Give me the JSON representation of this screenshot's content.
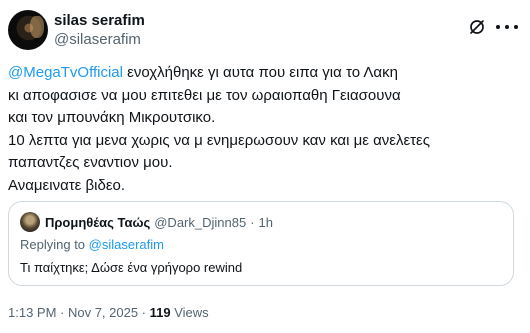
{
  "author": {
    "display_name": "silas serafim",
    "handle": "@silaserafim"
  },
  "tweet": {
    "mention": "@MegaTvOfficial",
    "line1_rest": " ενοχλήθηκε γι αυτα που ειπα για το Λακη",
    "line2": "κι αποφασισε να μου επιτεθει με τον ωραιοπαθη Γειασουνα",
    "line3": "και τον μπουνάκη Μικρουτσικο.",
    "line4": "10 λεπτα για μενα χωρις να μ ενημερωσουν καν και με ανελετες",
    "line5": "παπαντζες εναντιον μου.",
    "line6": "Αναμεινατε βιδεο."
  },
  "quoted_tweet": {
    "display_name": "Προμηθέας Ταώς",
    "handle": "@Dark_Djinn85",
    "separator": "·",
    "time": "1h",
    "replying_prefix": "Replying to ",
    "replying_to": "@silaserafim",
    "text": "Τι παίχτηκε; Δώσε ένα γρήγορο rewind"
  },
  "meta": {
    "timestamp": "1:13 PM · Nov 7, 2025 · ",
    "views_count": "119",
    "views_label": " Views"
  },
  "icons": {
    "grok": "grok-icon",
    "more": "more-icon"
  },
  "colors": {
    "accent": "#1d9bf0",
    "secondary_text": "#536471",
    "primary_text": "#0f1419",
    "border": "#cfd9de"
  }
}
